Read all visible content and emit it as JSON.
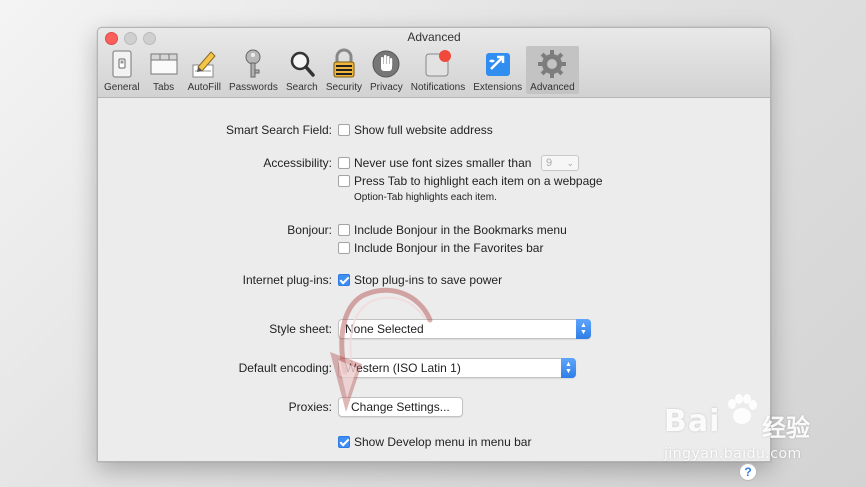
{
  "window": {
    "title": "Advanced"
  },
  "toolbar": {
    "items": [
      {
        "label": "General",
        "icon": "general-icon"
      },
      {
        "label": "Tabs",
        "icon": "tabs-icon"
      },
      {
        "label": "AutoFill",
        "icon": "autofill-icon"
      },
      {
        "label": "Passwords",
        "icon": "key-icon"
      },
      {
        "label": "Search",
        "icon": "magnifier-icon"
      },
      {
        "label": "Security",
        "icon": "lock-icon"
      },
      {
        "label": "Privacy",
        "icon": "hand-icon"
      },
      {
        "label": "Notifications",
        "icon": "notifications-icon"
      },
      {
        "label": "Extensions",
        "icon": "puzzle-icon"
      },
      {
        "label": "Advanced",
        "icon": "gear-icon"
      }
    ],
    "active": "Advanced"
  },
  "settings": {
    "smart_search": {
      "label": "Smart Search Field:",
      "option": "Show full website address",
      "checked": false
    },
    "accessibility": {
      "label": "Accessibility:",
      "option1": "Never use font sizes smaller than",
      "option1_checked": false,
      "font_size_value": "9",
      "option2": "Press Tab to highlight each item on a webpage",
      "option2_checked": false,
      "hint": "Option-Tab highlights each item."
    },
    "bonjour": {
      "label": "Bonjour:",
      "option1": "Include Bonjour in the Bookmarks menu",
      "option1_checked": false,
      "option2": "Include Bonjour in the Favorites bar",
      "option2_checked": false
    },
    "plugins": {
      "label": "Internet plug-ins:",
      "option": "Stop plug-ins to save power",
      "checked": true
    },
    "style_sheet": {
      "label": "Style sheet:",
      "value": "None Selected"
    },
    "encoding": {
      "label": "Default encoding:",
      "value": "Western (ISO Latin 1)"
    },
    "proxies": {
      "label": "Proxies:",
      "button": "Change Settings..."
    },
    "develop": {
      "option": "Show Develop menu in menu bar",
      "checked": true
    }
  },
  "help": {
    "label": "?"
  },
  "watermark": {
    "logo": "Bai",
    "cn": "经验",
    "url": "jingyan.baidu.com"
  },
  "colors": {
    "accent": "#3d8ef5",
    "close": "#fc605c",
    "annotation": "#b24a4a"
  }
}
